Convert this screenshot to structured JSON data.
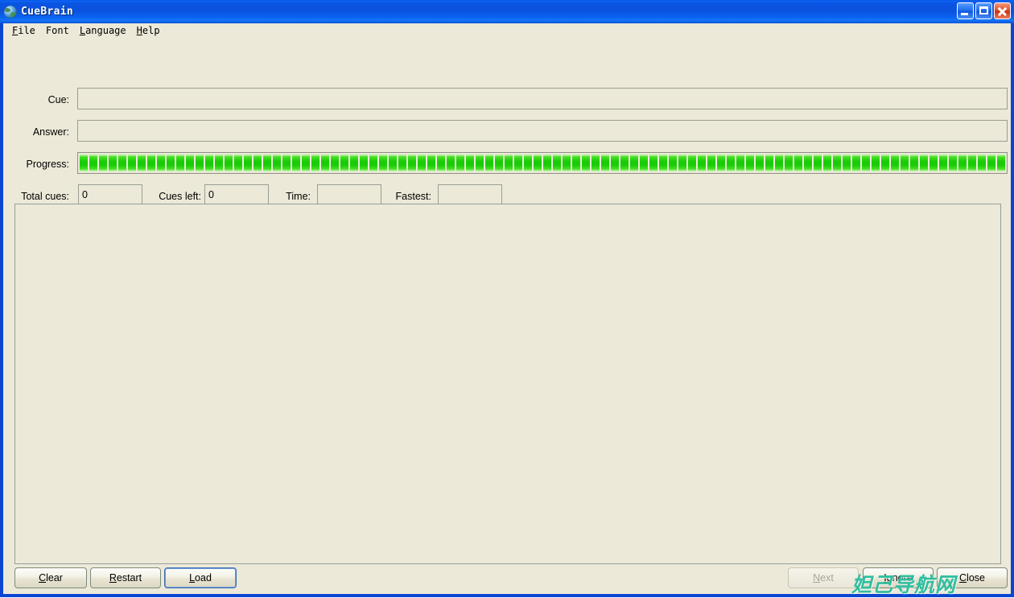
{
  "window": {
    "title": "CueBrain",
    "app_icon": "globe-icon",
    "caption": {
      "minimize": "minimize-icon",
      "maximize": "maximize-icon",
      "close": "close-icon"
    },
    "colors": {
      "titlebar_blue": "#0b51dd",
      "client_beige": "#ece9d8",
      "progress_green": "#18cc06",
      "watermark_teal": "#2fbfa0",
      "focus_blue": "#3c6fb5"
    }
  },
  "menubar": {
    "items": [
      {
        "label": "File",
        "accel": "F"
      },
      {
        "label": "Font",
        "accel": ""
      },
      {
        "label": "Language",
        "accel": "L"
      },
      {
        "label": "Help",
        "accel": "H"
      }
    ]
  },
  "form": {
    "cue": {
      "label": "Cue:",
      "value": "",
      "placeholder": ""
    },
    "answer": {
      "label": "Answer:",
      "value": "",
      "placeholder": ""
    },
    "progress": {
      "label": "Progress:",
      "percent": 100,
      "segments": 97
    },
    "stats": [
      {
        "label": "Total cues:",
        "value": "0"
      },
      {
        "label": "Cues left:",
        "value": "0"
      },
      {
        "label": "Time:",
        "value": ""
      },
      {
        "label": "Fastest:",
        "value": ""
      }
    ]
  },
  "text_area": {
    "content": ""
  },
  "buttons": {
    "left": [
      {
        "label": "Clear",
        "accel": "C",
        "state": "enabled"
      },
      {
        "label": "Restart",
        "accel": "R",
        "state": "enabled"
      },
      {
        "label": "Load",
        "accel": "L",
        "state": "default"
      }
    ],
    "right": [
      {
        "label": "Next",
        "accel": "N",
        "state": "disabled"
      },
      {
        "label": "Ignore",
        "accel": "I",
        "state": "enabled"
      },
      {
        "label": "Close",
        "accel": "C",
        "state": "enabled"
      }
    ]
  },
  "watermark": {
    "text": "妲己导航网"
  }
}
